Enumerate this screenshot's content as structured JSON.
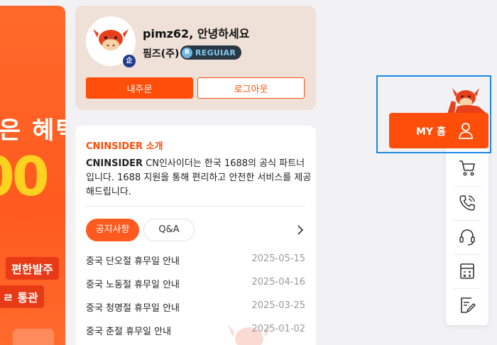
{
  "banner": {
    "headline": "혜택",
    "headline_prefix": "은",
    "amount_fragment": "00",
    "pill_1": "편한발주",
    "pill_2": "통관",
    "pill_2_prefix": "ㄹ"
  },
  "profile": {
    "greeting": "pimz62, 안녕하세요",
    "company": "핌즈(주)",
    "tier_badge_letter": "R",
    "tier_label": "REGUIAR",
    "corp_badge": "企",
    "orders_button": "내주문",
    "logout_button": "로그아웃"
  },
  "info": {
    "title": "CNINSIDER 소개",
    "desc_brand": "CNINSIDER",
    "desc_text": " CN인사이더는 한국 1688의 공식 파트너입니다. 1688 지원을 통해 편리하고 안전한 서비스를 제공해드립니다.",
    "tabs": [
      {
        "label": "공지사항",
        "active": true
      },
      {
        "label": "Q&A",
        "active": false
      }
    ],
    "notices": [
      {
        "title": "중국 단오절 휴무일 안내",
        "date": "2025-05-15"
      },
      {
        "title": "중국 노동절 휴무일 안내",
        "date": "2025-04-16"
      },
      {
        "title": "중국 청명절 휴무일 안내",
        "date": "2025-03-25"
      },
      {
        "title": "중국 춘절 휴무일 안내",
        "date": "2025-01-02"
      }
    ]
  },
  "quickbar": {
    "myhome_label": "MY 홈",
    "icons": [
      "cart-icon",
      "phone-icon",
      "headset-icon",
      "calculator-icon",
      "edit-note-icon"
    ]
  },
  "colors": {
    "accent": "#ff4d0a",
    "profile_bg": "#efe1d8",
    "frame_blue": "#1e88e5",
    "tier_bg": "#2b3845"
  }
}
